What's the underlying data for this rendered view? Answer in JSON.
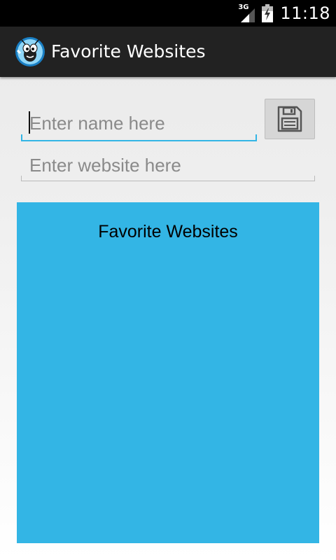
{
  "status_bar": {
    "network_type": "3G",
    "time": "11:18"
  },
  "action_bar": {
    "title": "Favorite Websites",
    "icon": "bug-mascot-icon"
  },
  "form": {
    "name_placeholder": "Enter name here",
    "name_value": "",
    "website_placeholder": "Enter website here",
    "website_value": "",
    "save_icon": "floppy-disk-icon"
  },
  "favorites": {
    "title": "Favorite Websites",
    "items": []
  },
  "colors": {
    "accent": "#33b5e5",
    "action_bar": "#222222",
    "status_bar": "#000000"
  }
}
